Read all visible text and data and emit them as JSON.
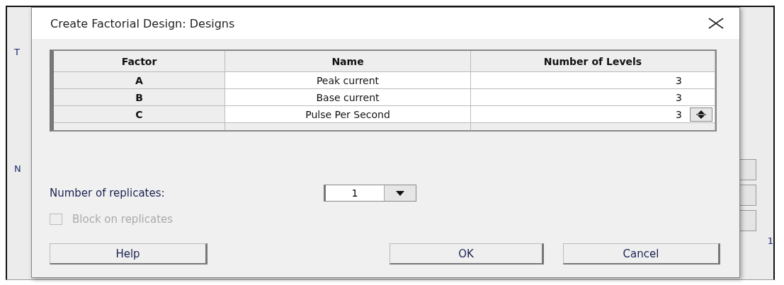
{
  "background_window": {
    "left_fragments": [
      "T",
      "N"
    ],
    "right_fragment": "1"
  },
  "dialog": {
    "title": "Create Factorial Design: Designs",
    "table": {
      "columns": [
        "Factor",
        "Name",
        "Number of Levels"
      ],
      "rows": [
        {
          "factor": "A",
          "name": "Peak current",
          "levels": "3",
          "selected": false
        },
        {
          "factor": "B",
          "name": "Base current",
          "levels": "3",
          "selected": false
        },
        {
          "factor": "C",
          "name": "Pulse Per Second",
          "levels": "3",
          "selected": true
        }
      ]
    },
    "replicates": {
      "label": "Number of replicates:",
      "value": "1"
    },
    "block": {
      "label": "Block on replicates",
      "checked": false,
      "disabled": true
    },
    "buttons": [
      "Help",
      "OK",
      "Cancel"
    ]
  }
}
